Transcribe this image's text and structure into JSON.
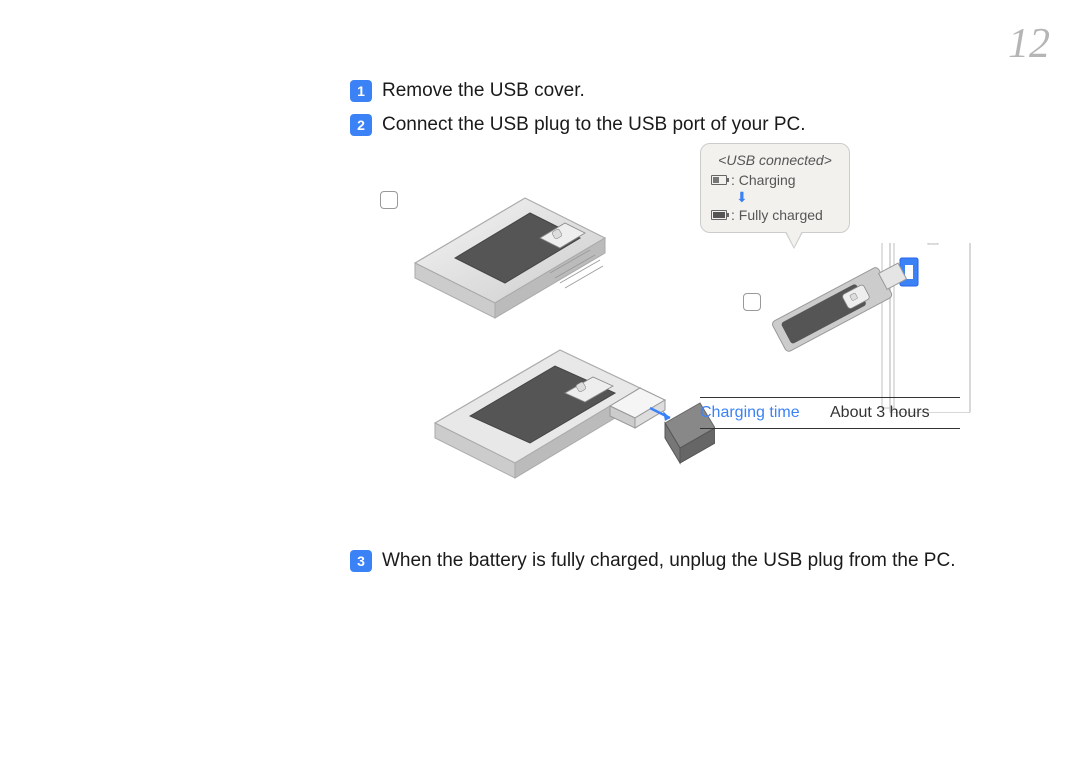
{
  "page_number": "12",
  "steps": [
    {
      "num": "1",
      "text": "Remove the USB cover."
    },
    {
      "num": "2",
      "text": "Connect the USB plug to the USB port of your PC."
    },
    {
      "num": "3",
      "text": "When the battery is fully charged, unplug the USB plug from the PC."
    }
  ],
  "tooltip": {
    "title": "<USB connected>",
    "charging_label": ": Charging",
    "full_label": ": Fully charged"
  },
  "charging_table": {
    "label": "Charging time",
    "value": "About 3 hours"
  }
}
